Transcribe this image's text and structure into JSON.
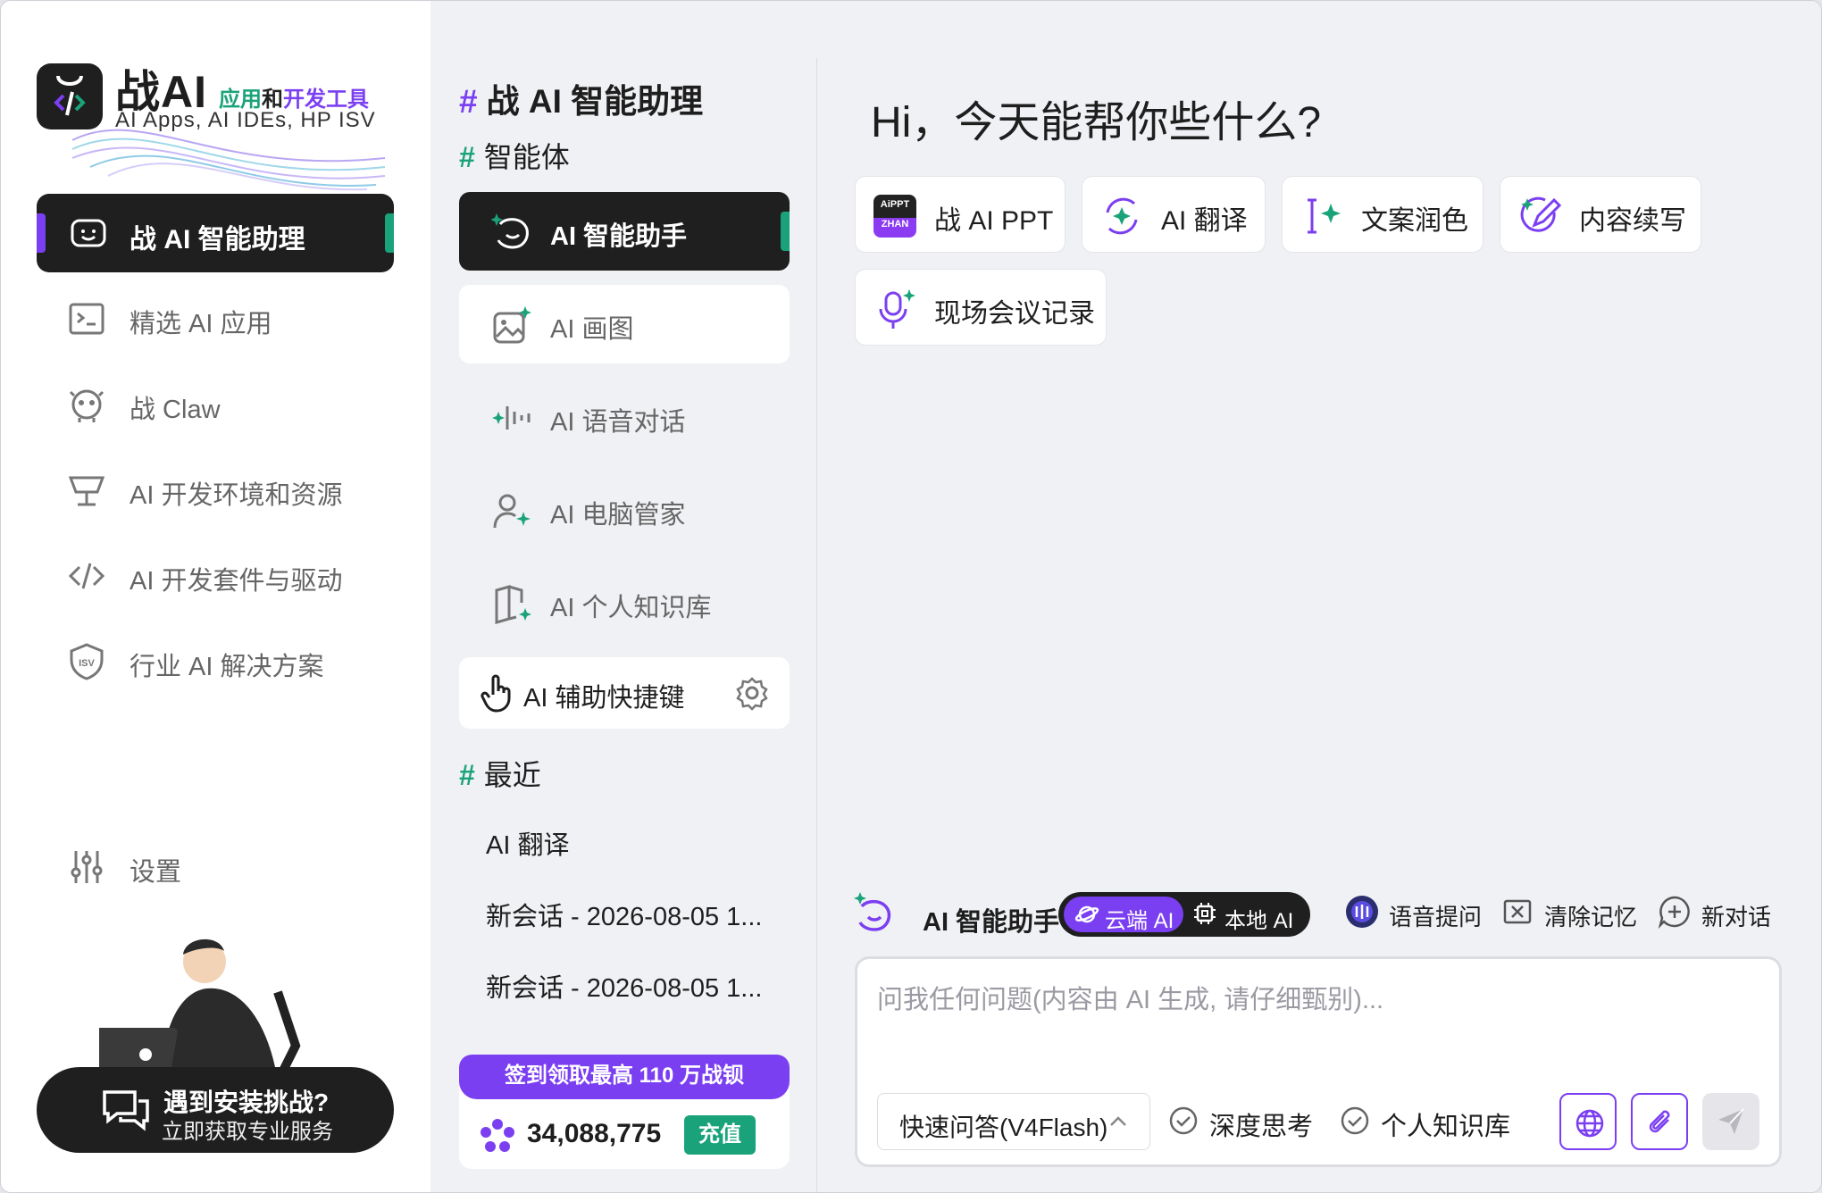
{
  "brand": {
    "title": "战AI",
    "tagline_part1": "应用",
    "tagline_part2": "和",
    "tagline_part3": "开发工具",
    "subtitle": "AI Apps, AI IDEs, HP ISV"
  },
  "sidebar": {
    "items": [
      {
        "label": "战 AI 智能助理",
        "icon": "robot-face-icon",
        "active": true
      },
      {
        "label": "精选 AI 应用",
        "icon": "terminal-icon"
      },
      {
        "label": "战 Claw",
        "icon": "claw-icon"
      },
      {
        "label": "AI 开发环境和资源",
        "icon": "desk-lamp-icon"
      },
      {
        "label": "AI 开发套件与驱动",
        "icon": "code-icon"
      },
      {
        "label": "行业 AI 解决方案",
        "icon": "isv-shield-icon"
      }
    ],
    "settings_label": "设置",
    "promo": {
      "line1": "遇到安装挑战?",
      "line2": "立即获取专业服务"
    }
  },
  "middle": {
    "title": "战 AI 智能助理",
    "agents_heading": "智能体",
    "agents": [
      {
        "label": "AI 智能助手",
        "active": true
      },
      {
        "label": "AI 画图"
      },
      {
        "label": "AI 语音对话"
      },
      {
        "label": "AI 电脑管家"
      },
      {
        "label": "AI 个人知识库"
      }
    ],
    "shortcut_label": "AI 辅助快捷键",
    "recent_heading": "最近",
    "recent": [
      "AI 翻译",
      "新会话 - 2026-08-05 1...",
      "新会话 - 2026-08-05 1..."
    ],
    "points": {
      "banner": "签到领取最高 110 万战钡",
      "value": "34,088,775",
      "recharge": "充值"
    }
  },
  "main": {
    "greeting": "Hi，今天能帮你些什么?",
    "quick_actions": [
      {
        "label": "战 AI PPT",
        "icon_top": "AiPPT",
        "icon_bottom": "ZHAN"
      },
      {
        "label": "AI 翻译"
      },
      {
        "label": "文案润色"
      },
      {
        "label": "内容续写"
      },
      {
        "label": "现场会议记录"
      }
    ],
    "toolbar": {
      "title": "AI 智能助手",
      "cloud": "云端 AI",
      "local": "本地 AI",
      "voice": "语音提问",
      "clear": "清除记忆",
      "new_chat": "新对话"
    },
    "input": {
      "placeholder": "问我任何问题(内容由 AI 生成, 请仔细甄别)...",
      "value": "",
      "model": "快速问答(V4Flash)",
      "deep_think": "深度思考",
      "knowledge": "个人知识库"
    }
  },
  "colors": {
    "accent": "#7b3ff2",
    "green": "#1aa37a",
    "dark": "#1f1f1f"
  }
}
